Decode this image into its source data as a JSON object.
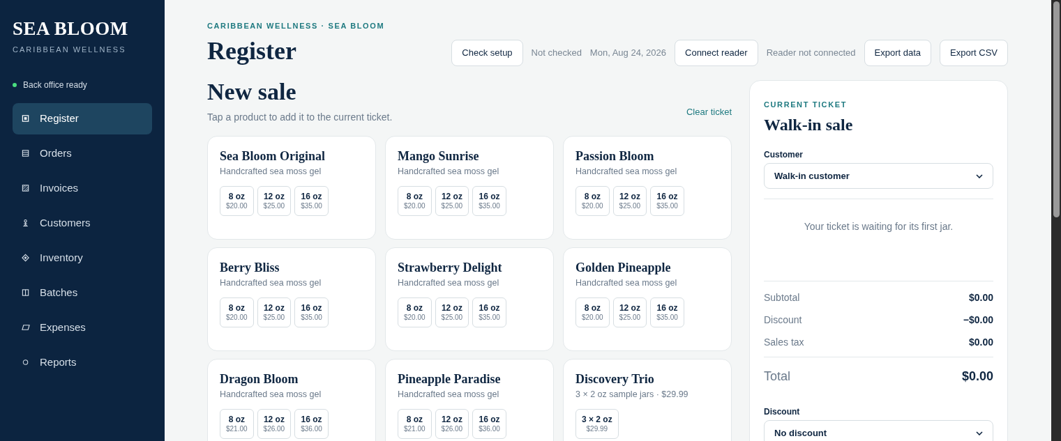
{
  "sidebar": {
    "brand": "SEA BLOOM",
    "tagline": "CARIBBEAN WELLNESS",
    "status": {
      "label": "Back office ready",
      "color": "#4ade80"
    },
    "items": [
      {
        "label": "Register",
        "selected": true
      },
      {
        "label": "Orders",
        "selected": false
      },
      {
        "label": "Invoices",
        "selected": false
      },
      {
        "label": "Customers",
        "selected": false
      },
      {
        "label": "Inventory",
        "selected": false
      },
      {
        "label": "Batches",
        "selected": false
      },
      {
        "label": "Expenses",
        "selected": false
      },
      {
        "label": "Reports",
        "selected": false
      }
    ]
  },
  "header": {
    "eyebrow": "CARIBBEAN WELLNESS · SEA BLOOM",
    "title": "Register",
    "toolbar": [
      {
        "kind": "button",
        "text": "Check setup"
      },
      {
        "kind": "text",
        "text": "Not checked"
      },
      {
        "kind": "text",
        "text": "Mon, Aug 24, 2026"
      },
      {
        "kind": "button",
        "text": "Connect reader"
      },
      {
        "kind": "text",
        "text": "Reader not connected"
      },
      {
        "kind": "button",
        "text": "Export data"
      },
      {
        "kind": "button",
        "text": "Export CSV"
      }
    ]
  },
  "sale": {
    "title": "New sale",
    "subtitle": "Tap a product to add it to the current ticket.",
    "clear_link": "Clear ticket",
    "products": [
      {
        "name": "Sea Bloom Original",
        "description": "Handcrafted sea moss gel",
        "variants": [
          {
            "size": "8 oz",
            "price": "$20.00"
          },
          {
            "size": "12 oz",
            "price": "$25.00"
          },
          {
            "size": "16 oz",
            "price": "$35.00"
          }
        ]
      },
      {
        "name": "Mango Sunrise",
        "description": "Handcrafted sea moss gel",
        "variants": [
          {
            "size": "8 oz",
            "price": "$20.00"
          },
          {
            "size": "12 oz",
            "price": "$25.00"
          },
          {
            "size": "16 oz",
            "price": "$35.00"
          }
        ]
      },
      {
        "name": "Passion Bloom",
        "description": "Handcrafted sea moss gel",
        "variants": [
          {
            "size": "8 oz",
            "price": "$20.00"
          },
          {
            "size": "12 oz",
            "price": "$25.00"
          },
          {
            "size": "16 oz",
            "price": "$35.00"
          }
        ]
      },
      {
        "name": "Berry Bliss",
        "description": "Handcrafted sea moss gel",
        "variants": [
          {
            "size": "8 oz",
            "price": "$20.00"
          },
          {
            "size": "12 oz",
            "price": "$25.00"
          },
          {
            "size": "16 oz",
            "price": "$35.00"
          }
        ]
      },
      {
        "name": "Strawberry Delight",
        "description": "Handcrafted sea moss gel",
        "variants": [
          {
            "size": "8 oz",
            "price": "$20.00"
          },
          {
            "size": "12 oz",
            "price": "$25.00"
          },
          {
            "size": "16 oz",
            "price": "$35.00"
          }
        ]
      },
      {
        "name": "Golden Pineapple",
        "description": "Handcrafted sea moss gel",
        "variants": [
          {
            "size": "8 oz",
            "price": "$20.00"
          },
          {
            "size": "12 oz",
            "price": "$25.00"
          },
          {
            "size": "16 oz",
            "price": "$35.00"
          }
        ]
      },
      {
        "name": "Dragon Bloom",
        "description": "Handcrafted sea moss gel",
        "variants": [
          {
            "size": "8 oz",
            "price": "$21.00"
          },
          {
            "size": "12 oz",
            "price": "$26.00"
          },
          {
            "size": "16 oz",
            "price": "$36.00"
          }
        ]
      },
      {
        "name": "Pineapple Paradise",
        "description": "Handcrafted sea moss gel",
        "variants": [
          {
            "size": "8 oz",
            "price": "$21.00"
          },
          {
            "size": "12 oz",
            "price": "$26.00"
          },
          {
            "size": "16 oz",
            "price": "$36.00"
          }
        ]
      },
      {
        "name": "Discovery Trio",
        "description": "3 × 2 oz sample jars · $29.99",
        "variants": [
          {
            "size": "3 × 2 oz",
            "price": "$29.99"
          }
        ]
      }
    ]
  },
  "ticket": {
    "eyebrow": "CURRENT TICKET",
    "title": "Walk-in sale",
    "customer_label": "Customer",
    "customer_value": "Walk-in customer",
    "empty_message": "Your ticket is waiting for its first jar.",
    "totals": [
      {
        "label": "Subtotal",
        "value": "$0.00"
      },
      {
        "label": "Discount",
        "value": "−$0.00"
      },
      {
        "label": "Sales tax",
        "value": "$0.00"
      }
    ],
    "total": {
      "label": "Total",
      "value": "$0.00"
    },
    "discount_label": "Discount",
    "discount_value": "No discount"
  }
}
